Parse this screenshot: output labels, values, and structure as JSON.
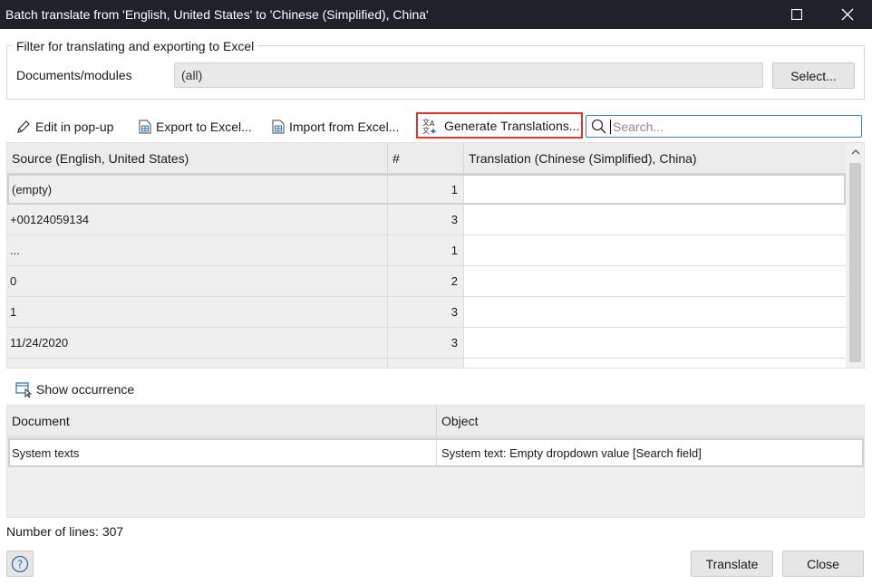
{
  "window": {
    "title": "Batch translate from 'English, United States' to 'Chinese (Simplified), China'",
    "icons": [
      "maximize-icon",
      "close-icon"
    ]
  },
  "filter": {
    "legend": "Filter for translating and exporting to Excel",
    "documents_label": "Documents/modules",
    "documents_value": "(all)",
    "select_label": "Select..."
  },
  "toolbar": {
    "edit_label": "Edit in pop-up",
    "export_label": "Export to Excel...",
    "import_label": "Import from Excel...",
    "generate_label": "Generate Translations...",
    "search_placeholder": "Search...",
    "highlight_color": "#e0342b"
  },
  "grid": {
    "columns": [
      "Source (English, United States)",
      "#",
      "Translation (Chinese (Simplified), China)"
    ],
    "rows": [
      {
        "source": "(empty)",
        "count": "1",
        "translation": ""
      },
      {
        "source": "+00124059134",
        "count": "3",
        "translation": ""
      },
      {
        "source": "...",
        "count": "1",
        "translation": ""
      },
      {
        "source": "0",
        "count": "2",
        "translation": ""
      },
      {
        "source": "1",
        "count": "3",
        "translation": ""
      },
      {
        "source": "11/24/2020",
        "count": "3",
        "translation": ""
      }
    ]
  },
  "occurrence": {
    "show_label": "Show occurrence",
    "columns": [
      "Document",
      "Object"
    ],
    "rows": [
      {
        "document": "System texts",
        "object": "System text: Empty dropdown value [Search field]"
      }
    ]
  },
  "footer": {
    "lines_text": "Number of lines: 307",
    "translate_label": "Translate",
    "close_label": "Close"
  }
}
